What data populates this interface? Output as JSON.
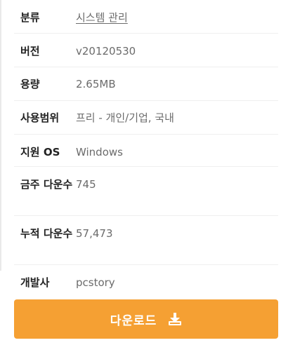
{
  "colors": {
    "accent": "#f5a033",
    "label_text": "#222222",
    "value_text": "#6b6b6b"
  },
  "info": {
    "category": {
      "label": "분류",
      "value": "시스템 관리"
    },
    "version": {
      "label": "버전",
      "value": "v20120530"
    },
    "size": {
      "label": "용량",
      "value": "2.65MB"
    },
    "usage": {
      "label": "사용범위",
      "value": "프리 - 개인/기업, 국내"
    },
    "os": {
      "label": "지원 OS",
      "value": "Windows"
    },
    "weekly_downloads": {
      "label": "금주 다운수",
      "value": "745"
    },
    "total_downloads": {
      "label": "누적 다운수",
      "value": "57,473"
    },
    "developer": {
      "label": "개발사",
      "value": "pcstory"
    }
  },
  "download": {
    "label": "다운로드",
    "icon": "download-icon"
  }
}
